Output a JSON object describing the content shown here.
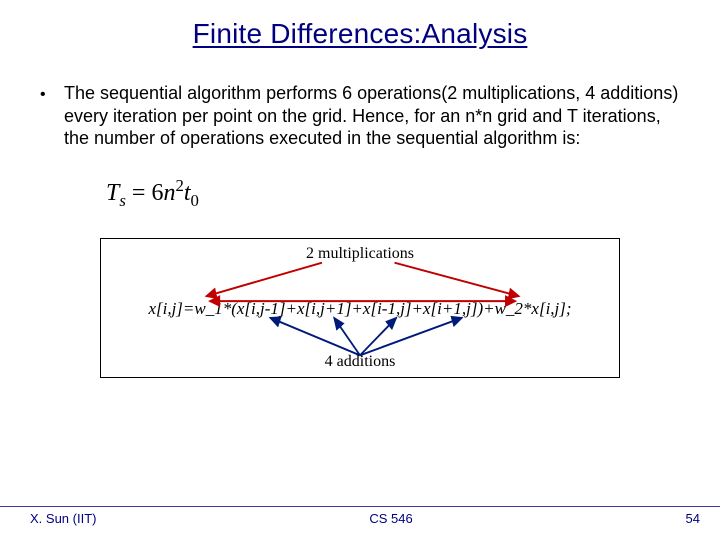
{
  "title": "Finite Differences:Analysis",
  "bullet": {
    "dot": "•",
    "text": "The sequential algorithm performs 6 operations(2 multiplications, 4 additions) every iteration per point on the grid. Hence, for an n*n grid and T iterations, the number of operations executed in the sequential algorithm is:"
  },
  "formula": {
    "T_var": "T",
    "T_sub": "s",
    "eq": " = ",
    "coef": "6",
    "n_var": "n",
    "n_sup": "2",
    "t_var": "t",
    "t_sub": "0"
  },
  "diagram": {
    "mult_label": "2 multiplications",
    "add_label": "4 additions",
    "code": "x[i,j]=w_1*(x[i,j-1]+x[i,j+1]+x[i-1,j]+x[i+1,j])+w_2*x[i,j];"
  },
  "footer": {
    "left": "X. Sun (IIT)",
    "center": "CS 546",
    "right": "54"
  }
}
